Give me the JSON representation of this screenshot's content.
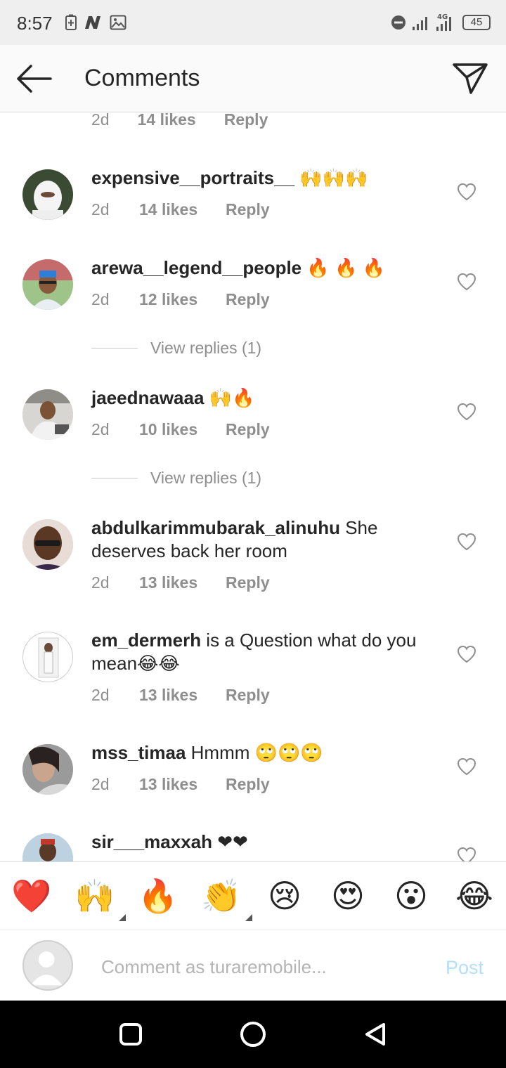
{
  "status_bar": {
    "time": "8:57",
    "network": "4G",
    "battery": "45",
    "icons": [
      "battery-saver-icon",
      "n-app-icon",
      "gallery-icon",
      "dnd-icon",
      "signal-icon",
      "signal-4g-icon",
      "battery-icon"
    ]
  },
  "header": {
    "title": "Comments",
    "back_icon": "arrow-left-icon",
    "share_icon": "send-icon"
  },
  "partial_top": {
    "time": "2d",
    "likes": "14 likes",
    "reply": "Reply"
  },
  "comments": [
    {
      "user": "expensive__portraits__",
      "text": " 🙌🙌🙌",
      "time": "2d",
      "likes": "14 likes",
      "reply": "Reply"
    },
    {
      "user": "arewa__legend__people",
      "text": " 🔥 🔥 🔥",
      "time": "2d",
      "likes": "12 likes",
      "reply": "Reply",
      "view_replies": "View replies (1)"
    },
    {
      "user": "jaeednawaaa",
      "text": " 🙌🔥",
      "time": "2d",
      "likes": "10 likes",
      "reply": "Reply",
      "view_replies": "View replies (1)"
    },
    {
      "user": "abdulkarimmubarak_alinuhu",
      "text": " She deserves back  her room",
      "time": "2d",
      "likes": "13 likes",
      "reply": "Reply"
    },
    {
      "user": "em_dermerh",
      "text": " is a Question  what do you mean😂😂",
      "time": "2d",
      "likes": "13 likes",
      "reply": "Reply"
    },
    {
      "user": "mss_timaa",
      "text": " Hmmm 🙄🙄🙄",
      "time": "2d",
      "likes": "13 likes",
      "reply": "Reply"
    },
    {
      "user": "sir___maxxah",
      "text": " ❤❤"
    }
  ],
  "reactions": [
    {
      "emoji": "❤️",
      "icon": "red-heart-icon"
    },
    {
      "emoji": "🙌",
      "icon": "raising-hands-icon",
      "has_variants": true
    },
    {
      "emoji": "🔥",
      "icon": "fire-icon"
    },
    {
      "emoji": "👏",
      "icon": "clapping-hands-icon",
      "has_variants": true
    },
    {
      "emoji": "😢",
      "icon": "crying-face-icon"
    },
    {
      "emoji": "😍",
      "icon": "heart-eyes-icon"
    },
    {
      "emoji": "😮",
      "icon": "surprised-face-icon"
    },
    {
      "emoji": "😂",
      "icon": "laughing-tears-icon"
    }
  ],
  "composer": {
    "placeholder": "Comment as turaremobile...",
    "value": "",
    "post_label": "Post"
  },
  "nav_bar": {
    "icons": [
      "recents-square-icon",
      "home-circle-icon",
      "back-triangle-icon"
    ]
  },
  "colors": {
    "text": "#262626",
    "secondary": "#8e8e8e",
    "post_disabled": "#b2dffc",
    "status_bar_bg": "#efefef",
    "header_bg": "#fafafa",
    "nav_bar_bg": "#000000"
  }
}
